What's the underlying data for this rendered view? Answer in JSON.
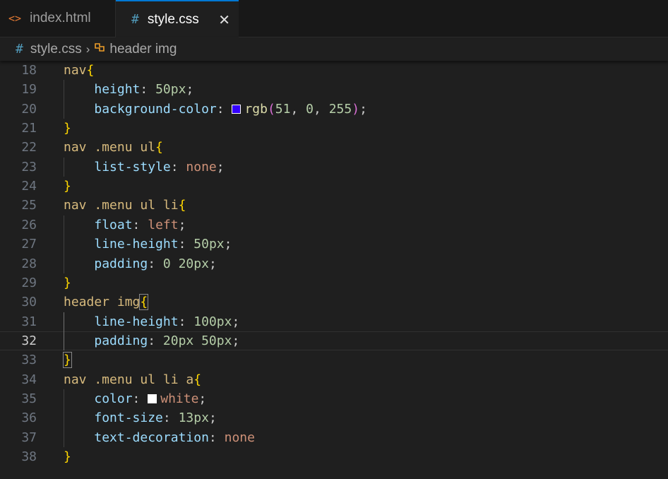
{
  "tabs": [
    {
      "icon": "<>",
      "label": "index.html",
      "active": false
    },
    {
      "icon": "#",
      "label": "style.css",
      "active": true,
      "close": "✕"
    }
  ],
  "breadcrumb": {
    "file_icon": "#",
    "file": "style.css",
    "separator": "›",
    "symbol": "header img"
  },
  "current_line": 32,
  "colors": {
    "swatch_rgb": "#3300ff",
    "swatch_white": "#ffffff",
    "accent": "#0078d4"
  },
  "lines": [
    {
      "number": "18",
      "tokens": [
        {
          "text": "nav",
          "type": "sel"
        },
        {
          "text": "{",
          "type": "b1"
        }
      ]
    },
    {
      "number": "19",
      "tokens": [
        {
          "text": "    "
        },
        {
          "text": "height",
          "type": "prop"
        },
        {
          "text": ": ",
          "type": "punc"
        },
        {
          "text": "50px",
          "type": "num"
        },
        {
          "text": ";",
          "type": "punc"
        }
      ]
    },
    {
      "number": "20",
      "tokens": [
        {
          "text": "    "
        },
        {
          "text": "background-color",
          "type": "prop"
        },
        {
          "text": ": ",
          "type": "punc"
        },
        {
          "swatch": "#3300ff"
        },
        {
          "text": "rgb",
          "type": "fn"
        },
        {
          "text": "(",
          "type": "b2"
        },
        {
          "text": "51",
          "type": "num"
        },
        {
          "text": ", ",
          "type": "punc"
        },
        {
          "text": "0",
          "type": "num"
        },
        {
          "text": ", ",
          "type": "punc"
        },
        {
          "text": "255",
          "type": "num"
        },
        {
          "text": ")",
          "type": "b2"
        },
        {
          "text": ";",
          "type": "punc"
        }
      ]
    },
    {
      "number": "21",
      "tokens": [
        {
          "text": "}",
          "type": "b1"
        }
      ]
    },
    {
      "number": "22",
      "tokens": [
        {
          "text": "nav .menu ul",
          "type": "sel"
        },
        {
          "text": "{",
          "type": "b1"
        }
      ]
    },
    {
      "number": "23",
      "tokens": [
        {
          "text": "    "
        },
        {
          "text": "list-style",
          "type": "prop"
        },
        {
          "text": ": ",
          "type": "punc"
        },
        {
          "text": "none",
          "type": "val"
        },
        {
          "text": ";",
          "type": "punc"
        }
      ]
    },
    {
      "number": "24",
      "tokens": [
        {
          "text": "}",
          "type": "b1"
        }
      ]
    },
    {
      "number": "25",
      "tokens": [
        {
          "text": "nav .menu ul li",
          "type": "sel"
        },
        {
          "text": "{",
          "type": "b1"
        }
      ]
    },
    {
      "number": "26",
      "tokens": [
        {
          "text": "    "
        },
        {
          "text": "float",
          "type": "prop"
        },
        {
          "text": ": ",
          "type": "punc"
        },
        {
          "text": "left",
          "type": "val"
        },
        {
          "text": ";",
          "type": "punc"
        }
      ]
    },
    {
      "number": "27",
      "tokens": [
        {
          "text": "    "
        },
        {
          "text": "line-height",
          "type": "prop"
        },
        {
          "text": ": ",
          "type": "punc"
        },
        {
          "text": "50px",
          "type": "num"
        },
        {
          "text": ";",
          "type": "punc"
        }
      ]
    },
    {
      "number": "28",
      "tokens": [
        {
          "text": "    "
        },
        {
          "text": "padding",
          "type": "prop"
        },
        {
          "text": ": ",
          "type": "punc"
        },
        {
          "text": "0 20px",
          "type": "num"
        },
        {
          "text": ";",
          "type": "punc"
        }
      ]
    },
    {
      "number": "29",
      "tokens": [
        {
          "text": "}",
          "type": "b1"
        }
      ]
    },
    {
      "number": "30",
      "tokens": [
        {
          "text": "header img",
          "type": "sel"
        },
        {
          "text": "{",
          "type": "b1",
          "hl": true
        }
      ]
    },
    {
      "number": "31",
      "tokens": [
        {
          "text": "    "
        },
        {
          "text": "line-height",
          "type": "prop"
        },
        {
          "text": ": ",
          "type": "punc"
        },
        {
          "text": "100px",
          "type": "num"
        },
        {
          "text": ";",
          "type": "punc"
        }
      ]
    },
    {
      "number": "32",
      "tokens": [
        {
          "text": "    "
        },
        {
          "text": "padding",
          "type": "prop"
        },
        {
          "text": ": ",
          "type": "punc"
        },
        {
          "text": "20px 50px",
          "type": "num"
        },
        {
          "text": ";",
          "type": "punc"
        }
      ]
    },
    {
      "number": "33",
      "tokens": [
        {
          "text": "}",
          "type": "b1",
          "hl": true
        }
      ]
    },
    {
      "number": "34",
      "tokens": [
        {
          "text": "nav .menu ul li a",
          "type": "sel"
        },
        {
          "text": "{",
          "type": "b1"
        }
      ]
    },
    {
      "number": "35",
      "tokens": [
        {
          "text": "    "
        },
        {
          "text": "color",
          "type": "prop"
        },
        {
          "text": ": ",
          "type": "punc"
        },
        {
          "swatch": "#ffffff"
        },
        {
          "text": "white",
          "type": "val"
        },
        {
          "text": ";",
          "type": "punc"
        }
      ]
    },
    {
      "number": "36",
      "tokens": [
        {
          "text": "    "
        },
        {
          "text": "font-size",
          "type": "prop"
        },
        {
          "text": ": ",
          "type": "punc"
        },
        {
          "text": "13px",
          "type": "num"
        },
        {
          "text": ";",
          "type": "punc"
        }
      ]
    },
    {
      "number": "37",
      "tokens": [
        {
          "text": "    "
        },
        {
          "text": "text-decoration",
          "type": "prop"
        },
        {
          "text": ": ",
          "type": "punc"
        },
        {
          "text": "none",
          "type": "val"
        }
      ]
    },
    {
      "number": "38",
      "tokens": [
        {
          "text": "}",
          "type": "b1"
        }
      ]
    }
  ]
}
